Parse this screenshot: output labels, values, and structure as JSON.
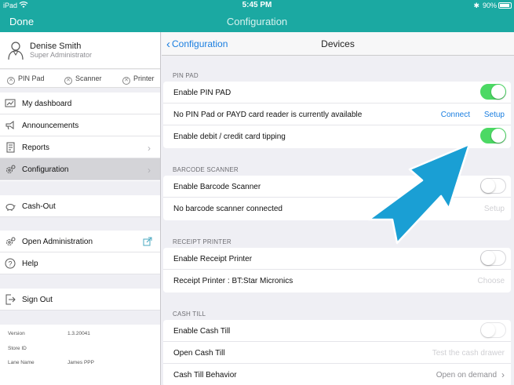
{
  "status": {
    "device": "iPad",
    "time": "5:45 PM",
    "bluetooth": "✱",
    "battery": "90%"
  },
  "nav": {
    "done": "Done",
    "title": "Configuration"
  },
  "user": {
    "name": "Denise Smith",
    "role": "Super Administrator"
  },
  "devices_bar": [
    {
      "label": "PIN Pad"
    },
    {
      "label": "Scanner"
    },
    {
      "label": "Printer"
    }
  ],
  "menu": {
    "dashboard": "My dashboard",
    "announcements": "Announcements",
    "reports": "Reports",
    "configuration": "Configuration",
    "cashout": "Cash-Out",
    "open_admin": "Open Administration",
    "help": "Help",
    "signout": "Sign Out"
  },
  "info": {
    "version_label": "Version",
    "version_value": "1.3.20041",
    "store_label": "Store ID",
    "store_value": "",
    "lane_label": "Lane Name",
    "lane_value": "James PPP"
  },
  "subnav": {
    "back": "Configuration",
    "title": "Devices"
  },
  "sections": {
    "pinpad": {
      "header": "PIN PAD",
      "enable": "Enable PIN PAD",
      "enable_on": true,
      "status": "No PIN Pad or PAYD card reader is currently available",
      "connect": "Connect",
      "setup": "Setup",
      "tipping": "Enable debit / credit card tipping",
      "tipping_on": true
    },
    "barcode": {
      "header": "BARCODE SCANNER",
      "enable": "Enable Barcode Scanner",
      "enable_on": false,
      "status": "No barcode scanner connected",
      "setup": "Setup"
    },
    "receipt": {
      "header": "RECEIPT PRINTER",
      "enable": "Enable Receipt Printer",
      "enable_on": false,
      "printer": "Receipt Printer : BT:Star Micronics",
      "choose": "Choose"
    },
    "cashtill": {
      "header": "CASH TILL",
      "enable": "Enable Cash Till",
      "enable_on": false,
      "open": "Open Cash Till",
      "test": "Test the cash drawer",
      "behavior": "Cash Till Behavior",
      "behavior_value": "Open on demand"
    }
  },
  "colors": {
    "accent": "#1ba9a2",
    "link": "#1a7ee0",
    "toggle_on": "#4cd964",
    "annotation_arrow": "#1a9fd4"
  }
}
